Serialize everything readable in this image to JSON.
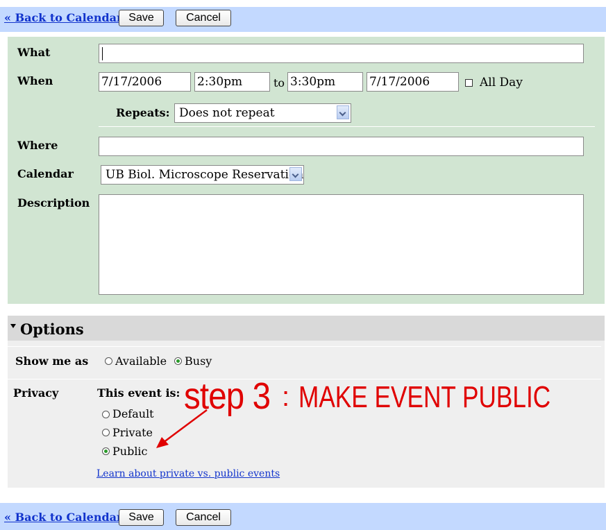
{
  "top_bar": {
    "back_link": "« Back to Calendar",
    "save": "Save",
    "cancel": "Cancel"
  },
  "event": {
    "what_label": "What",
    "what_value": "",
    "when_label": "When",
    "start_date": "7/17/2006",
    "start_time": "2:30pm",
    "to_label": "to",
    "end_time": "3:30pm",
    "end_date": "7/17/2006",
    "all_day_label": "All Day",
    "repeats_label": "Repeats:",
    "repeats_value": "Does not repeat",
    "where_label": "Where",
    "where_value": "",
    "calendar_label": "Calendar",
    "calendar_value": "UB Biol. Microscope Reservations",
    "description_label": "Description",
    "description_value": ""
  },
  "options": {
    "title": "Options",
    "show_me_as_label": "Show me as",
    "available": "Available",
    "busy": "Busy",
    "privacy_label": "Privacy",
    "this_event_is": "This event is:",
    "default": "Default",
    "private": "Private",
    "public": "Public",
    "learn_link": "Learn about private vs. public events"
  },
  "annotation": {
    "step": "step 3",
    "colon": ":",
    "text": "MAKE EVENT PUBLIC",
    "color": "#e00000"
  },
  "bottom_bar": {
    "back_link": "« Back to Calendar",
    "save": "Save",
    "cancel": "Cancel"
  },
  "colors": {
    "bar": "#c3d9ff",
    "event_panel": "#d1e5d2",
    "options_panel": "#efefef",
    "link": "#1133cc",
    "radio_selected": "#2a9a2a"
  }
}
